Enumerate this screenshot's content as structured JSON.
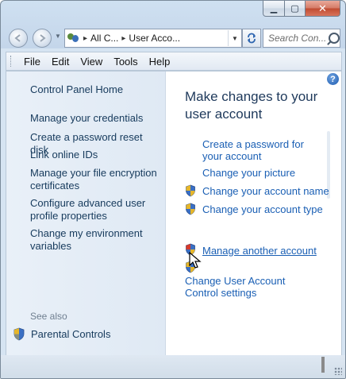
{
  "caption_buttons": {
    "minimize": "▁",
    "maximize": "▢",
    "close": "✕"
  },
  "address_bar": {
    "crumbs": [
      "All C...",
      "User Acco..."
    ],
    "separator": "▸",
    "search_placeholder": "Search Con..."
  },
  "menu": [
    "File",
    "Edit",
    "View",
    "Tools",
    "Help"
  ],
  "left_pane": {
    "home": "Control Panel Home",
    "tasks": [
      "Manage your credentials",
      "Create a password reset disk",
      "Link online IDs",
      "Manage your file encryption certificates",
      "Configure advanced user profile properties",
      "Change my environment variables"
    ],
    "see_also": "See also",
    "parental_controls": "Parental Controls"
  },
  "right_pane": {
    "title": "Make changes to your user account",
    "links": [
      "Create a password for your account",
      "Change your picture",
      "Change your account name",
      "Change your account type"
    ],
    "manage_another": "Manage another account",
    "uac": "Change User Account Control settings"
  },
  "help_label": "?",
  "icons": {
    "shield": "uac-shield-icon",
    "help": "help-icon",
    "refresh": "refresh-icon",
    "search": "search-icon",
    "users": "user-accounts-icon"
  }
}
